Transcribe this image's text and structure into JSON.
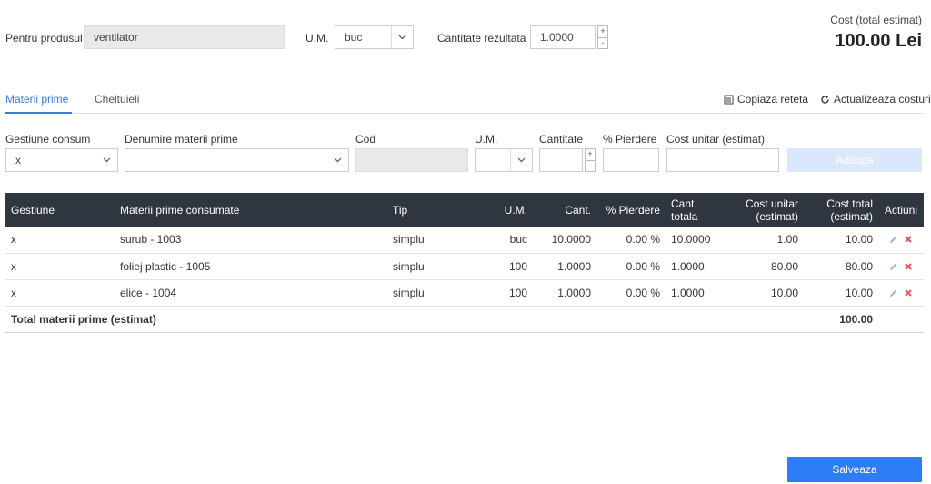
{
  "header": {
    "product_label": "Pentru produsul",
    "product_value": "ventilator",
    "um_label": "U.M.",
    "um_value": "buc",
    "qty_label": "Cantitate rezultata",
    "qty_value": "1.0000",
    "cost_title": "Cost (total estimat)",
    "cost_value": "100.00 Lei"
  },
  "tabs": [
    {
      "label": "Materii prime",
      "active": true
    },
    {
      "label": "Cheltuieli",
      "active": false
    }
  ],
  "actions": {
    "copy_recipe": "Copiaza reteta",
    "update_costs": "Actualizeaza costuri"
  },
  "add_form": {
    "gestiune_label": "Gestiune consum",
    "gestiune_value": "x",
    "denumire_label": "Denumire materii prime",
    "denumire_value": "",
    "cod_label": "Cod",
    "um_label": "U.M.",
    "cantitate_label": "Cantitate",
    "pierdere_label": "% Pierdere",
    "cost_label": "Cost unitar (estimat)",
    "add_button": "Adauga"
  },
  "table": {
    "headers": {
      "gestiune": "Gestiune",
      "materii": "Materii prime consumate",
      "tip": "Tip",
      "um": "U.M.",
      "cant": "Cant.",
      "pierdere": "% Pierdere",
      "cant_totala": "Cant. totala",
      "cost_unitar_1": "Cost unitar",
      "cost_unitar_2": "(estimat)",
      "cost_total_1": "Cost total",
      "cost_total_2": "(estimat)",
      "actiuni": "Actiuni"
    },
    "rows": [
      {
        "gestiune": "x",
        "materie": "surub - 1003",
        "tip": "simplu",
        "um": "buc",
        "cant": "10.0000",
        "pierdere": "0.00 %",
        "cant_totala": "10.0000",
        "cost_unitar": "1.00",
        "cost_total": "10.00"
      },
      {
        "gestiune": "x",
        "materie": "foliej plastic - 1005",
        "tip": "simplu",
        "um": "100",
        "cant": "1.0000",
        "pierdere": "0.00 %",
        "cant_totala": "1.0000",
        "cost_unitar": "80.00",
        "cost_total": "80.00"
      },
      {
        "gestiune": "x",
        "materie": "elice - 1004",
        "tip": "simplu",
        "um": "100",
        "cant": "1.0000",
        "pierdere": "0.00 %",
        "cant_totala": "1.0000",
        "cost_unitar": "10.00",
        "cost_total": "10.00"
      }
    ],
    "footer_label": "Total materii prime (estimat)",
    "footer_total": "100.00"
  },
  "save_button": "Salveaza",
  "colors": {
    "accent": "#3a7bd5",
    "header_bg": "#2f3640",
    "save_bg": "#2e7cf6",
    "add_bg": "#dbe8fb"
  }
}
